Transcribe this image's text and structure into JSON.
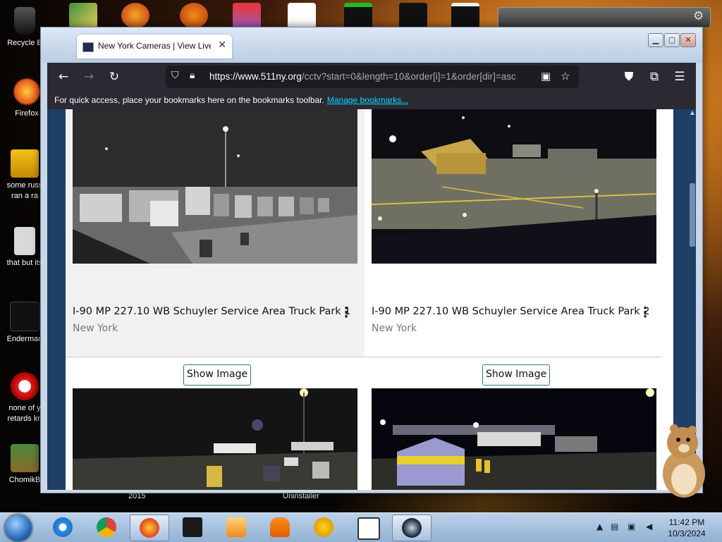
{
  "desktop": {
    "icons": [
      {
        "label": "Recycle B"
      },
      {
        "label": "Firefox"
      },
      {
        "label": "some russ\nran a ra"
      },
      {
        "label": "that but its"
      },
      {
        "label": "Enderman"
      },
      {
        "label": "none of y\nretards kn"
      },
      {
        "label": "ChomikB"
      }
    ],
    "below_labels": [
      "2015",
      "Uninstaller"
    ]
  },
  "browser": {
    "tab_title": "New York Cameras | View Live N",
    "tab_close": "✕",
    "url_host": "https://www.511ny.org",
    "url_path": "/cctv?start=0&length=10&order[i]=1&order[dir]=asc",
    "bookmarks_message": "For quick access, place your bookmarks here on the bookmarks toolbar.",
    "bookmarks_link": "Manage bookmarks...",
    "window_buttons": {
      "minimize": "▁",
      "maximize": "▢",
      "close": "✕"
    }
  },
  "cameras": [
    {
      "title": "I-90 MP 227.10 WB Schuyler Service Area Truck Park 1",
      "location": "New York",
      "button": "Show Image"
    },
    {
      "title": "I-90 MP 227.10 WB Schuyler Service Area Truck Park 2",
      "location": "New York",
      "button": "Show Image"
    }
  ],
  "taskbar": {
    "time": "11:42 PM",
    "date": "10/3/2024",
    "apps": [
      "internet-explorer",
      "chrome",
      "firefox",
      "black-box",
      "media-player",
      "vlc",
      "aimp",
      "calendar-321",
      "steam"
    ]
  },
  "colors": {
    "browser_chrome": "#2b2a33",
    "url_bg": "#1c1b22",
    "link": "#00ddff",
    "button_border": "#2b7a78"
  }
}
